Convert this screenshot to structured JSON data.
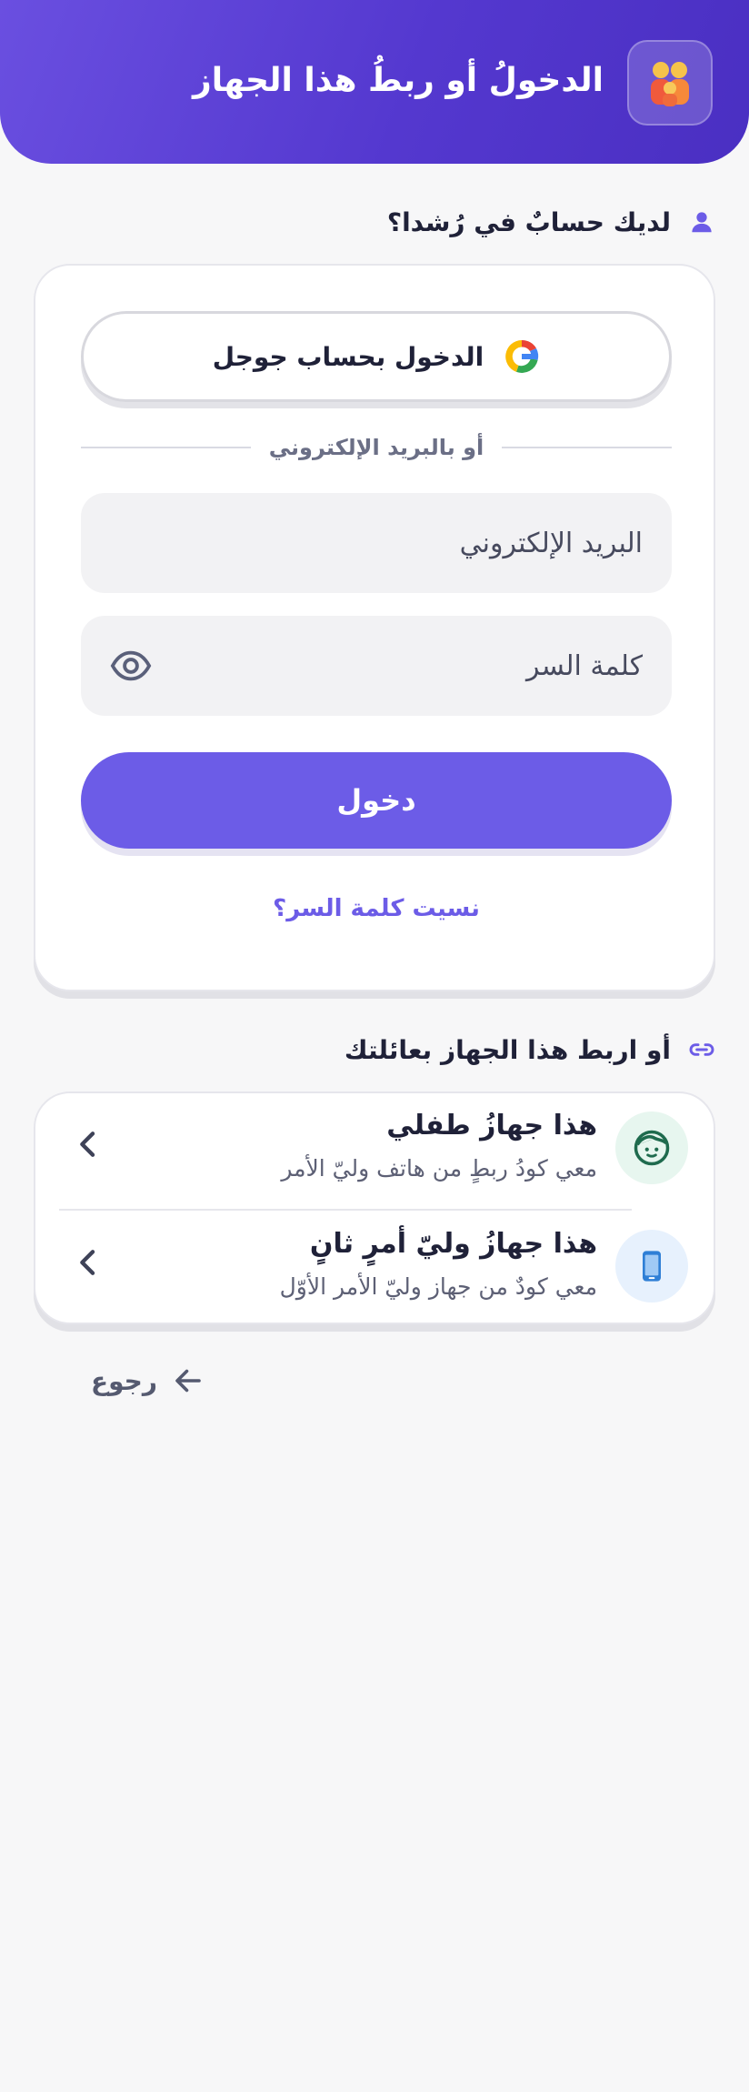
{
  "header": {
    "title": "الدخولُ أو ربطُ هذا الجهاز",
    "logo_icon": "family-emoji-icon"
  },
  "login_section": {
    "heading": "لديك حسابٌ في رُشدا؟",
    "heading_icon": "person-icon"
  },
  "login_card": {
    "google_label": "الدخول بحساب جوجل",
    "divider_text": "أو بالبريد الإلكتروني",
    "email_placeholder": "البريد الإلكتروني",
    "password_placeholder": "كلمة السر",
    "submit_label": "دخول",
    "forgot_label": "نسيت كلمة السر؟"
  },
  "link_section": {
    "heading": "أو اربط هذا الجهاز بعائلتك",
    "heading_icon": "link-icon"
  },
  "link_options": [
    {
      "title": "هذا جهازُ طفلي",
      "subtitle": "معي كودُ ربطٍ من هاتف وليّ الأمر",
      "icon": "child-face-icon",
      "badge_color": "#e7f6ef"
    },
    {
      "title": "هذا جهازُ وليّ أمرٍ ثانٍ",
      "subtitle": "معي كودٌ من جهاز وليّ الأمر الأوّل",
      "icon": "phone-icon",
      "badge_color": "#e7f1fd"
    }
  ],
  "back_label": "رجوع",
  "colors": {
    "primary": "#6c5ce7",
    "header_gradient_start": "#6a4fe0",
    "header_gradient_end": "#4a2fc2",
    "text_dark": "#1f2138"
  }
}
